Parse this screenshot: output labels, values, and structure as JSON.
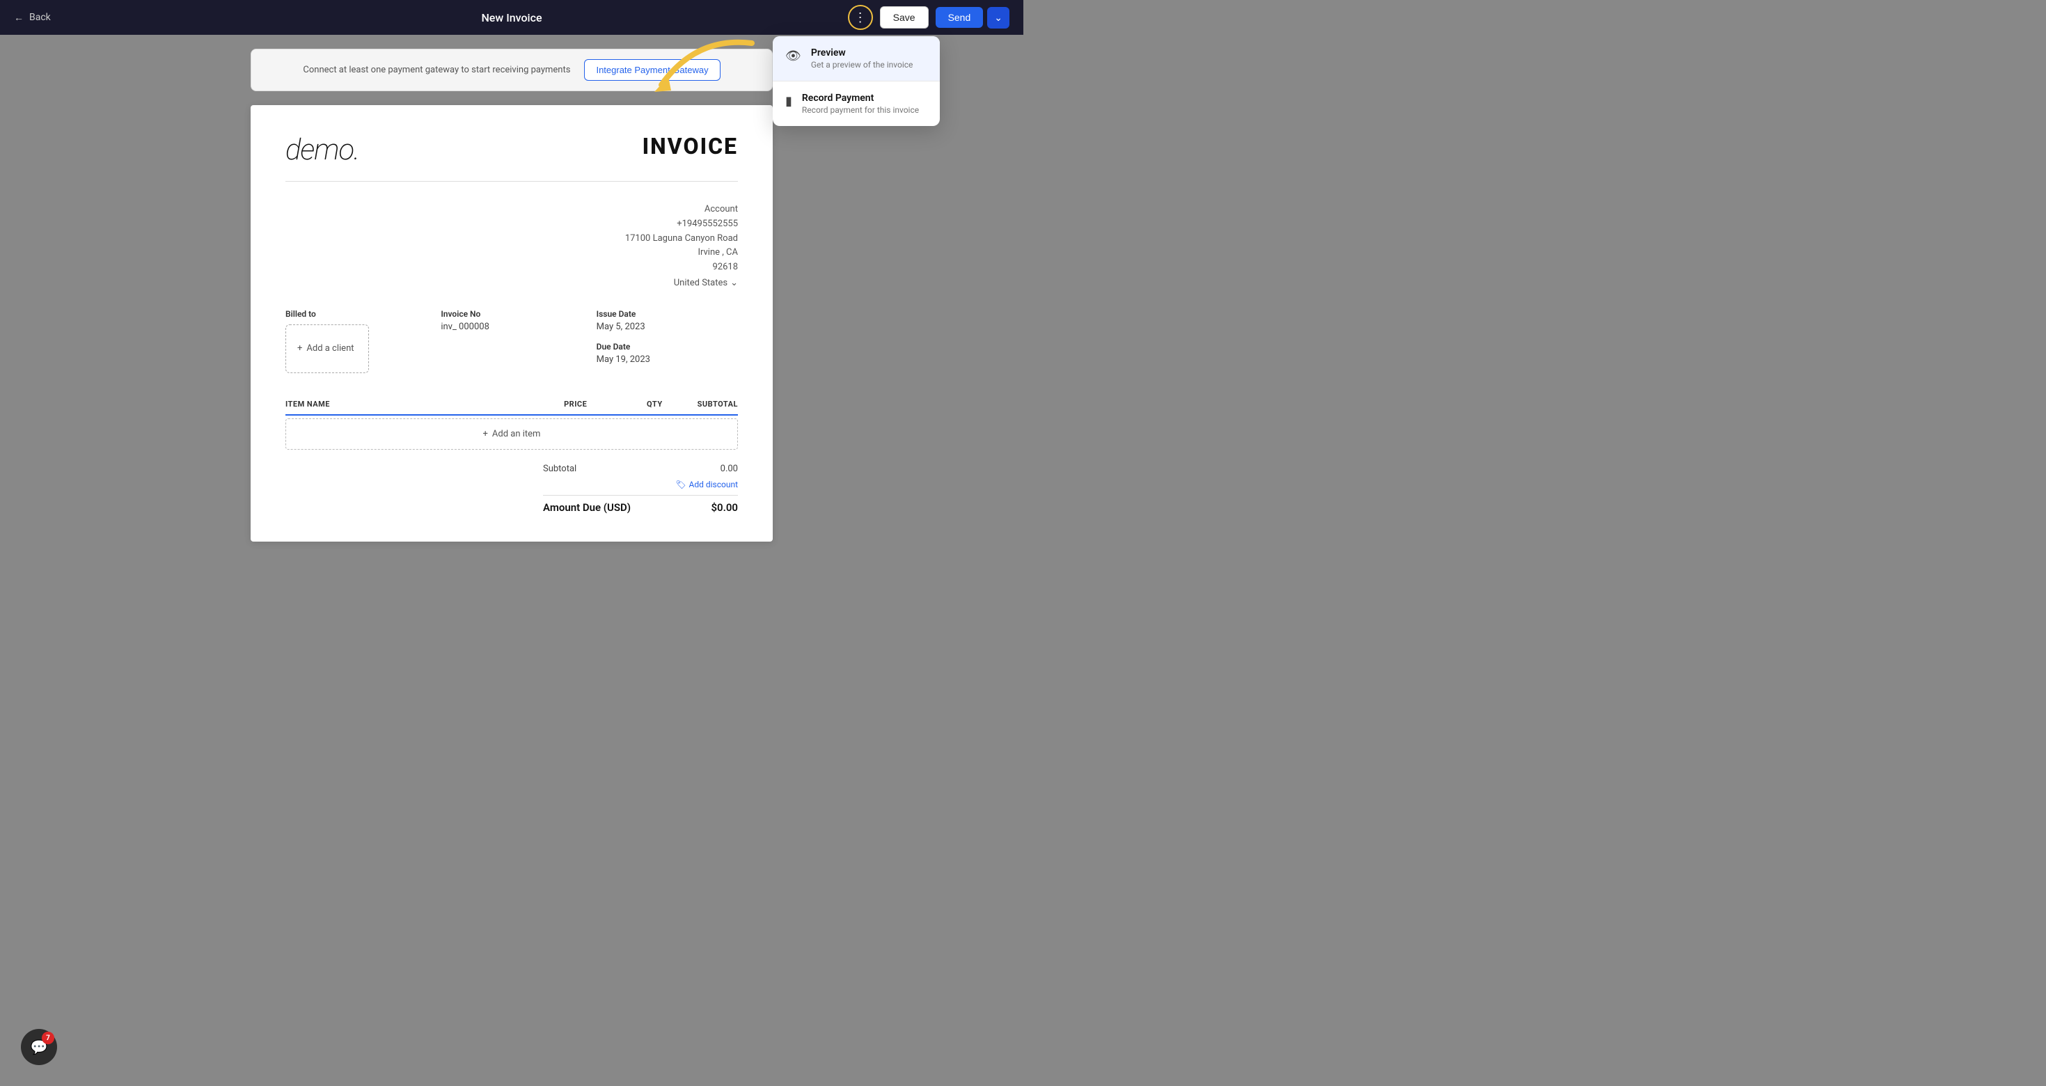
{
  "nav": {
    "back_label": "Back",
    "title": "New Invoice",
    "save_label": "Save",
    "send_label": "Send"
  },
  "dropdown": {
    "preview": {
      "title": "Preview",
      "description": "Get a preview of the invoice"
    },
    "record_payment": {
      "title": "Record Payment",
      "description": "Record payment for this invoice"
    }
  },
  "banner": {
    "text": "Connect at least one payment gateway to start receiving payments",
    "integrate_label": "Integrate Payment Gateway"
  },
  "invoice": {
    "title": "INVOICE",
    "logo_text": "demo.",
    "account_label": "Account",
    "phone": "+19495552555",
    "address_line1": "17100 Laguna Canyon Road",
    "address_city": "Irvine ,  CA",
    "address_zip": "92618",
    "country": "United States",
    "billed_to_label": "Billed to",
    "add_client_label": "Add a client",
    "invoice_no_label": "Invoice No",
    "invoice_no_value": "inv_  000008",
    "issue_date_label": "Issue Date",
    "issue_date_value": "May 5, 2023",
    "due_date_label": "Due Date",
    "due_date_value": "May 19, 2023",
    "col_item": "ITEM NAME",
    "col_price": "PRICE",
    "col_qty": "QTY",
    "col_subtotal": "SUBTOTAL",
    "add_item_label": "Add an item",
    "subtotal_label": "Subtotal",
    "subtotal_value": "0.00",
    "add_discount_label": "Add discount",
    "amount_due_label": "Amount Due (USD)",
    "amount_due_value": "$0.00"
  },
  "chat": {
    "badge_count": "7"
  }
}
